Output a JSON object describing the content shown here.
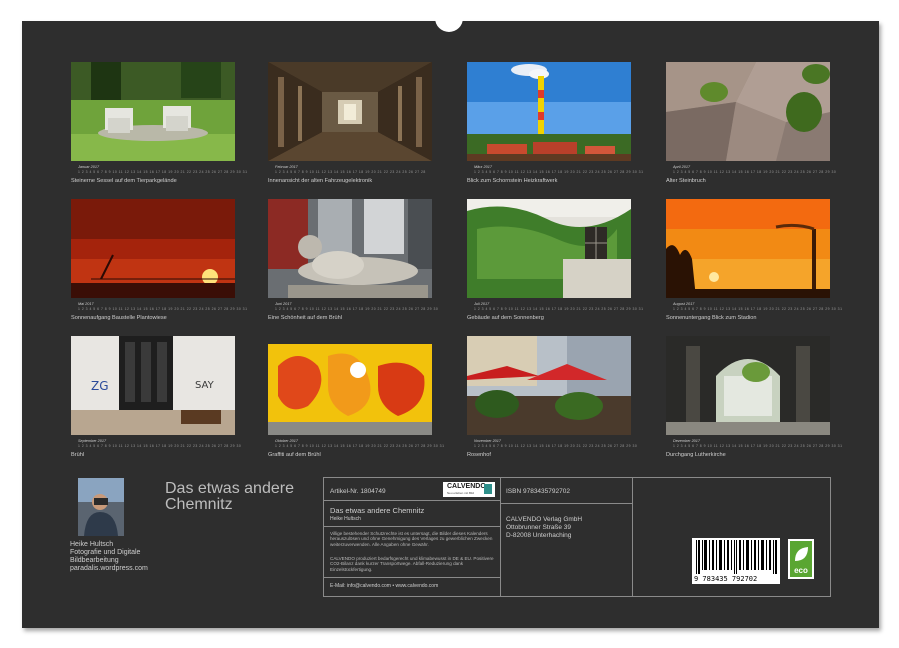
{
  "calendar_title": "Das etwas andere Chemnitz",
  "photos": [
    {
      "month": "Januar 2017",
      "caption": "Steinerne Sessel auf dem Tierparkgelände"
    },
    {
      "month": "Februar 2017",
      "caption": "Innenansicht der alten Fahrzeugelektronik"
    },
    {
      "month": "März 2017",
      "caption": "Blick zum Schornstein Heizkraftwerk"
    },
    {
      "month": "April 2017",
      "caption": "Alter Steinbruch"
    },
    {
      "month": "Mai 2017",
      "caption": "Sonnenaufgang Baustelle Plantowiese"
    },
    {
      "month": "Juni 2017",
      "caption": "Eine Schönheit auf dem Brühl"
    },
    {
      "month": "Juli 2017",
      "caption": "Gebäude auf dem Sonnenberg"
    },
    {
      "month": "August 2017",
      "caption": "Sonnenuntergang Blick zum Stadion"
    },
    {
      "month": "September 2017",
      "caption": "Brühl"
    },
    {
      "month": "Oktober 2017",
      "caption": "Graffiti auf dem Brühl"
    },
    {
      "month": "November 2017",
      "caption": "Rosenhof"
    },
    {
      "month": "Dezember 2017",
      "caption": "Durchgang Lutherkirche"
    }
  ],
  "author": {
    "name": "Heike Hultsch",
    "line2": "Fotografie und Digitale",
    "line3": "Bildbearbeitung",
    "line4": "paradalis.wordpress.com"
  },
  "info": {
    "article_no": "Artikel-Nr. 1804749",
    "calvendo_logo": "CALVENDO",
    "calvendo_tagline": "Neu erleben mit Bild",
    "product_title": "Das etwas andere Chemnitz",
    "product_author": "Heike Hultsch",
    "legal_text": "Villige bestehender Schutzrechte ist es untersagt, die Bilder dieses Kalenders herauszulösen und ohne Genehmigung des Verlages zu gewerblichen Zwecken weiterzuverwenden. Alle Angaben ohne Gewähr.",
    "eco_text": "CALVENDO produziert bedarfsgerecht und klimabewusst in DE & EU. Positivere CO2-Bilanz dank kurzer Transportwege. Abfall-Reduzierung dank Einzelstückfertigung.",
    "email_line": "E-Mail: info@calvendo.com • www.calvendo.com",
    "isbn": "ISBN 9783435792702",
    "publisher_name": "CALVENDO Verlag GmbH",
    "publisher_street": "Ottobrunner Straße 39",
    "publisher_city": "D-82008 Unterhaching",
    "barcode_number": "9 783435 792702",
    "eco_badge": "eco"
  }
}
